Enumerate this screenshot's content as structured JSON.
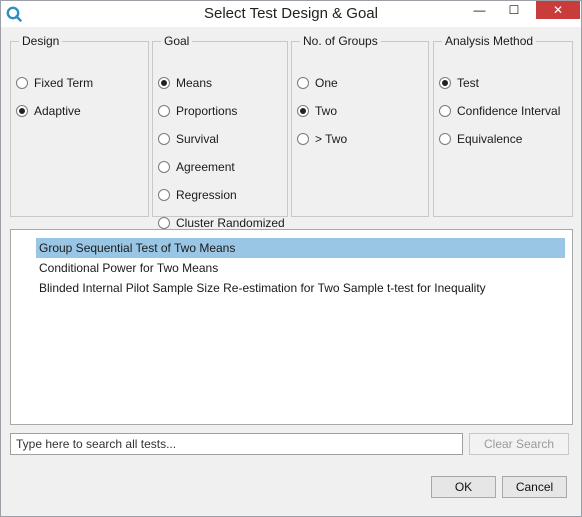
{
  "window": {
    "title": "Select Test Design & Goal",
    "minimize": "—",
    "maximize": "☐",
    "close": "✕",
    "icon": "search-icon",
    "accent": "#2f8fc4"
  },
  "design": {
    "legend": "Design",
    "options": [
      {
        "label": "Fixed Term",
        "selected": false
      },
      {
        "label": "Adaptive",
        "selected": true
      }
    ]
  },
  "goal": {
    "legend": "Goal",
    "options": [
      {
        "label": "Means",
        "selected": true
      },
      {
        "label": "Proportions",
        "selected": false
      },
      {
        "label": "Survival",
        "selected": false
      },
      {
        "label": "Agreement",
        "selected": false
      },
      {
        "label": "Regression",
        "selected": false
      },
      {
        "label": "Cluster Randomized",
        "selected": false
      }
    ]
  },
  "groups": {
    "legend": "No. of Groups",
    "options": [
      {
        "label": "One",
        "selected": false
      },
      {
        "label": "Two",
        "selected": true
      },
      {
        "label": "> Two",
        "selected": false
      }
    ]
  },
  "analysis": {
    "legend": "Analysis Method",
    "options": [
      {
        "label": "Test",
        "selected": true
      },
      {
        "label": "Confidence Interval",
        "selected": false
      },
      {
        "label": "Equivalence",
        "selected": false
      }
    ]
  },
  "results": [
    {
      "label": "Group Sequential Test of Two Means",
      "selected": true
    },
    {
      "label": "Conditional Power for Two Means",
      "selected": false
    },
    {
      "label": "Blinded Internal Pilot Sample Size Re-estimation for Two Sample t-test for Inequality",
      "selected": false
    }
  ],
  "search": {
    "placeholder": "Type here to search all tests...",
    "value": "",
    "clear_label": "Clear Search"
  },
  "footer": {
    "ok_label": "OK",
    "cancel_label": "Cancel"
  },
  "colors": {
    "selection": "#9ac6e6",
    "close_button": "#c83c3c"
  }
}
